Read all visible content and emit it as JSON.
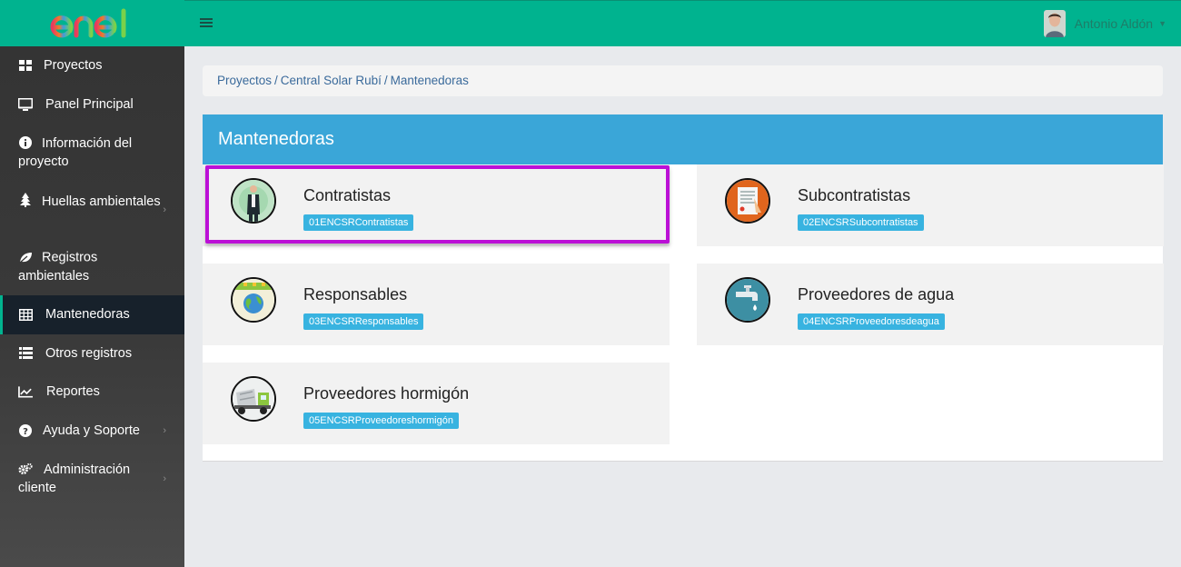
{
  "brand": {
    "logo_text": "enel"
  },
  "sidebar": {
    "items": [
      {
        "label": "Proyectos",
        "icon": "grid-icon"
      },
      {
        "label": "Panel Principal",
        "icon": "monitor-icon"
      },
      {
        "label": "Información del proyecto",
        "icon": "info-icon"
      },
      {
        "label": "Huellas ambientales",
        "icon": "tree-icon"
      },
      {
        "label": "Registros ambientales",
        "icon": "leaf-icon"
      },
      {
        "label": "Mantenedoras",
        "icon": "table-icon"
      },
      {
        "label": "Otros registros",
        "icon": "list-icon"
      },
      {
        "label": "Reportes",
        "icon": "chart-icon"
      },
      {
        "label": "Ayuda y Soporte",
        "icon": "question-icon"
      },
      {
        "label": "Administración cliente",
        "icon": "gears-icon"
      }
    ]
  },
  "header": {
    "user_name": "Antonio Aldón"
  },
  "breadcrumb": {
    "items": [
      "Proyectos",
      "Central Solar Rubí",
      "Mantenedoras"
    ],
    "separator": "/"
  },
  "panel": {
    "title": "Mantenedoras",
    "cards": [
      {
        "title": "Contratistas",
        "code": "01ENCSRContratistas",
        "icon": "worker-icon"
      },
      {
        "title": "Subcontratistas",
        "code": "02ENCSRSubcontratistas",
        "icon": "document-icon"
      },
      {
        "title": "Responsables",
        "code": "03ENCSRResponsables",
        "icon": "globe-icon"
      },
      {
        "title": "Proveedores de agua",
        "code": "04ENCSRProveedoresdeagua",
        "icon": "water-tap-icon"
      },
      {
        "title": "Proveedores hormigón",
        "code": "05ENCSRProveedoreshormigón",
        "icon": "concrete-truck-icon"
      }
    ]
  },
  "colors": {
    "brand_green": "#00b38f",
    "panel_header": "#3aa6d8",
    "badge": "#38b3e0",
    "highlight": "#bb10d6"
  }
}
